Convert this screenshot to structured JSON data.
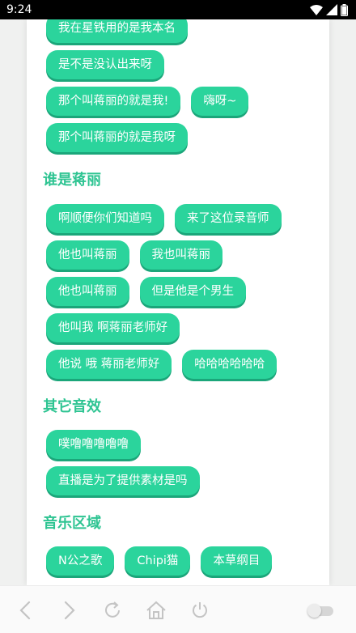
{
  "status_bar": {
    "time": "9:24"
  },
  "sections": [
    {
      "title": "",
      "rows": [
        [
          "我在星铁用的是我本名"
        ],
        [
          "是不是没认出来呀"
        ],
        [
          "那个叫蒋丽的就是我!",
          "嗨呀~"
        ],
        [
          "那个叫蒋丽的就是我呀"
        ]
      ]
    },
    {
      "title": "谁是蒋丽",
      "rows": [
        [
          "啊顺便你们知道吗",
          "来了这位录音师"
        ],
        [
          "他也叫蒋丽",
          "我也叫蒋丽"
        ],
        [
          "他也叫蒋丽",
          "但是他是个男生"
        ],
        [
          "他叫我 啊蒋丽老师好"
        ],
        [
          "他说 哦 蒋丽老师好",
          "哈哈哈哈哈哈"
        ]
      ]
    },
    {
      "title": "其它音效",
      "rows": [
        [
          "噗噜噜噜噜噜"
        ],
        [
          "直播是为了提供素材是吗"
        ]
      ]
    },
    {
      "title": "音乐区域",
      "rows": [
        [
          "N公之歌",
          "Chipi猫",
          "本草纲目"
        ]
      ]
    }
  ],
  "nav_icons": [
    "back-icon",
    "forward-icon",
    "refresh-icon",
    "home-icon",
    "power-icon"
  ],
  "colors": {
    "accent": "#2ec492",
    "chip": "#2bd49c",
    "chip_shadow": "#1ba67a"
  },
  "toggle": {
    "on": false
  }
}
